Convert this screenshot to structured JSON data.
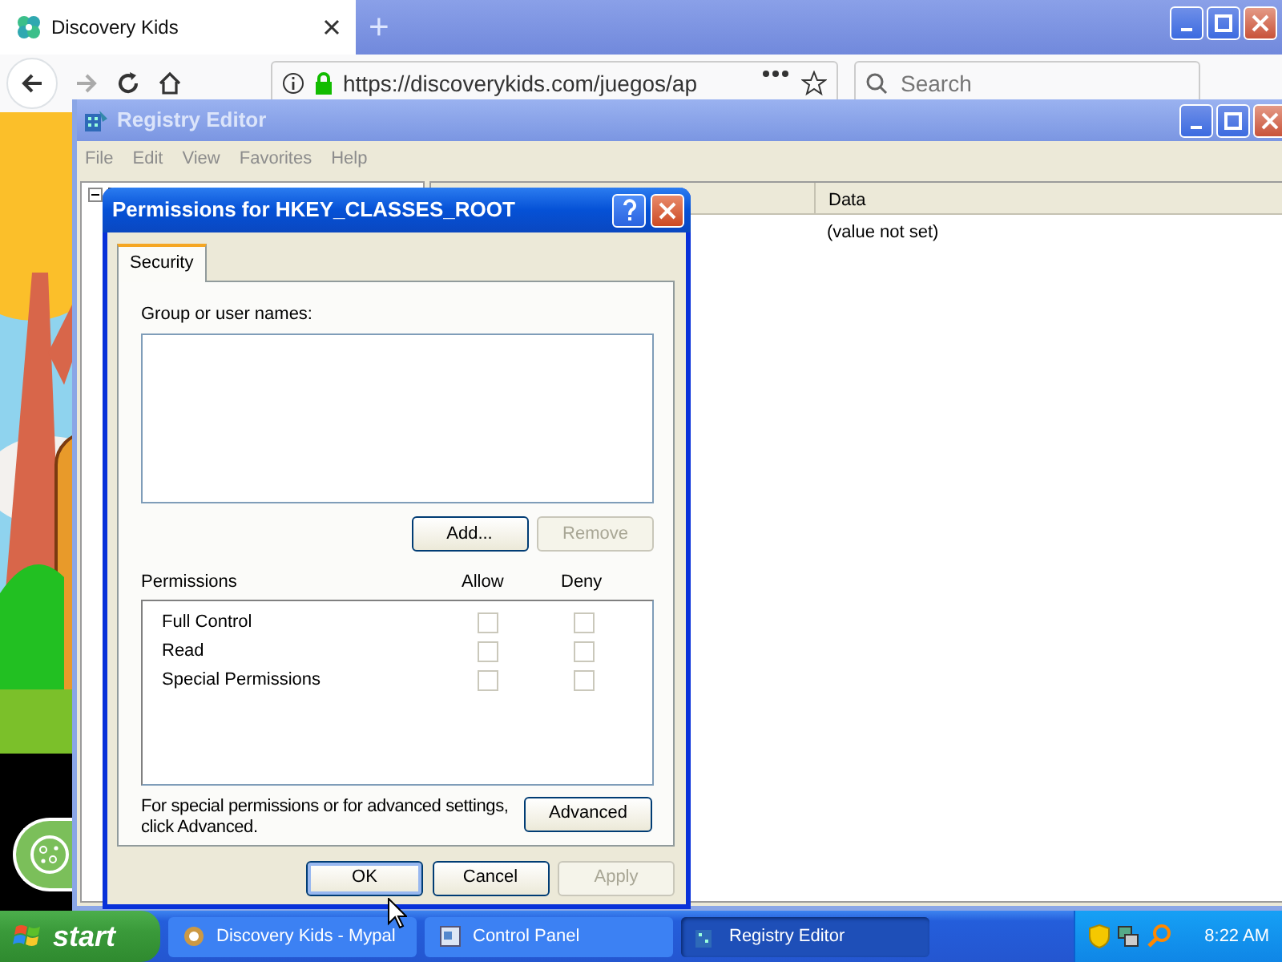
{
  "browser": {
    "tabs": [
      {
        "title": "Discovery Kids",
        "selected": true
      }
    ],
    "new_tab": "+",
    "url": "https://discoverykids.com/juegos/ap",
    "search": {
      "placeholder": "Search"
    }
  },
  "registry_editor": {
    "title": "Registry Editor",
    "menu": [
      "File",
      "Edit",
      "View",
      "Favorites",
      "Help"
    ],
    "columns": [
      "Data"
    ],
    "rows": [
      {
        "data": "(value not set)"
      }
    ]
  },
  "dialog": {
    "title": "Permissions for HKEY_CLASSES_ROOT",
    "tabs": [
      {
        "label": "Security",
        "selected": true
      }
    ],
    "group_label": "Group or user names:",
    "list_buttons": [
      {
        "label": "Add...",
        "disabled": false
      },
      {
        "label": "Remove",
        "disabled": true
      }
    ],
    "permissions_label": "Permissions",
    "allow_label": "Allow",
    "deny_label": "Deny",
    "permissions": [
      {
        "name": "Full Control",
        "allow": false,
        "deny": false,
        "disabled": true
      },
      {
        "name": "Read",
        "allow": false,
        "deny": false,
        "disabled": true
      },
      {
        "name": "Special Permissions",
        "allow": false,
        "deny": false,
        "disabled": true
      }
    ],
    "advanced_text": "For special permissions or for advanced settings,\nclick Advanced.",
    "advanced_button": "Advanced",
    "buttons": [
      {
        "label": "OK",
        "disabled": false,
        "default": true
      },
      {
        "label": "Cancel",
        "disabled": false,
        "default": false
      },
      {
        "label": "Apply",
        "disabled": true,
        "default": false
      }
    ]
  },
  "taskbar": {
    "start": "start",
    "tasks": [
      {
        "label": "Discovery Kids - Mypal",
        "selected": false
      },
      {
        "label": "Control Panel",
        "selected": false
      },
      {
        "label": "Registry Editor",
        "selected": true
      }
    ],
    "clock": "8:22 AM"
  }
}
